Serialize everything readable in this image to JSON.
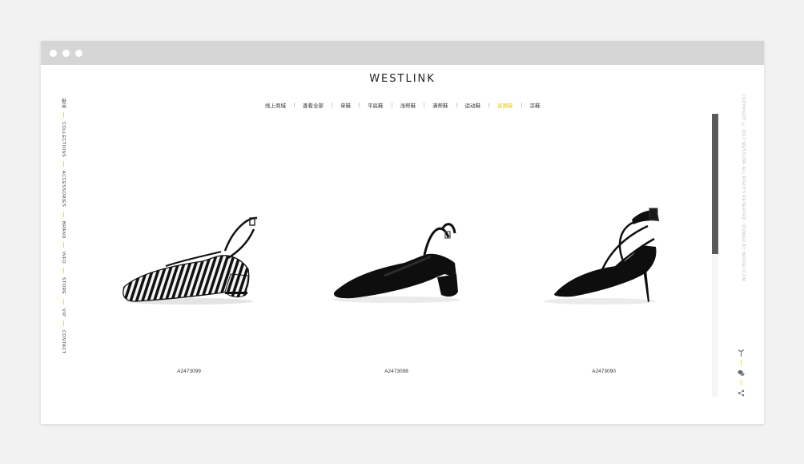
{
  "brand": {
    "logo": "WESTLINK"
  },
  "nav": {
    "items": [
      {
        "label": "线上商城",
        "active": false
      },
      {
        "label": "查看全部",
        "active": false
      },
      {
        "label": "单鞋",
        "active": false
      },
      {
        "label": "平底鞋",
        "active": false
      },
      {
        "label": "浅帮鞋",
        "active": false
      },
      {
        "label": "满帮鞋",
        "active": false
      },
      {
        "label": "运动鞋",
        "active": false
      },
      {
        "label": "高跟鞋",
        "active": true
      },
      {
        "label": "凉鞋",
        "active": false
      }
    ]
  },
  "sidebar": {
    "items": [
      "鞋品",
      "COLLECTIONS",
      "ACCESSORIES",
      "BRAND",
      "INFO",
      "STORE",
      "VIP",
      "CONTACT"
    ]
  },
  "copyright": "COPYRIGHT © 2017 WESTLINK ALL RIGHTS RESERVED · POWER BY INFIDELICOM",
  "products": [
    {
      "sku": "A2473099",
      "image": "zebra-slingback-shoe"
    },
    {
      "sku": "A2473098",
      "image": "black-slingback-shoe"
    },
    {
      "sku": "A2473090",
      "image": "black-strappy-heel"
    }
  ],
  "right_icons": [
    "weibo-icon",
    "wechat-icon",
    "share-icon"
  ],
  "colors": {
    "accent": "#e9c80d",
    "background": "#f2f2f2",
    "titlebar": "#d6d6d6",
    "scrollbar": "#5a5a5a"
  }
}
